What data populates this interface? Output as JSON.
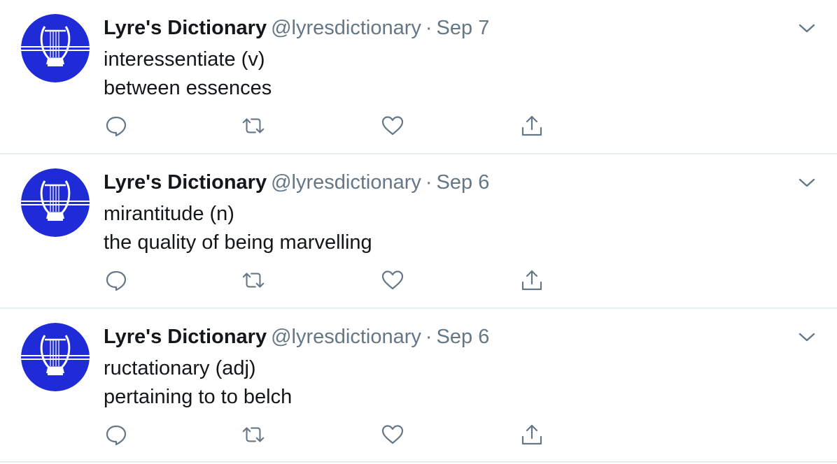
{
  "colors": {
    "name": "#14171a",
    "secondary": "#657786",
    "avatar_blue": "#1f2bd6",
    "divider": "#e6ecf0"
  },
  "icons": {
    "reply": "reply-icon",
    "retweet": "retweet-icon",
    "like": "like-icon",
    "share": "share-icon",
    "more": "chevron-down-icon"
  },
  "tweets": [
    {
      "name": "Lyre's Dictionary",
      "handle": "@lyresdictionary",
      "separator": "·",
      "date": "Sep 7",
      "word": "interessentiate (v)",
      "definition": "between essences"
    },
    {
      "name": "Lyre's Dictionary",
      "handle": "@lyresdictionary",
      "separator": "·",
      "date": "Sep 6",
      "word": "mirantitude (n)",
      "definition": "the quality of being marvelling"
    },
    {
      "name": "Lyre's Dictionary",
      "handle": "@lyresdictionary",
      "separator": "·",
      "date": "Sep 6",
      "word": "ructationary (adj)",
      "definition": "pertaining to to belch"
    }
  ]
}
